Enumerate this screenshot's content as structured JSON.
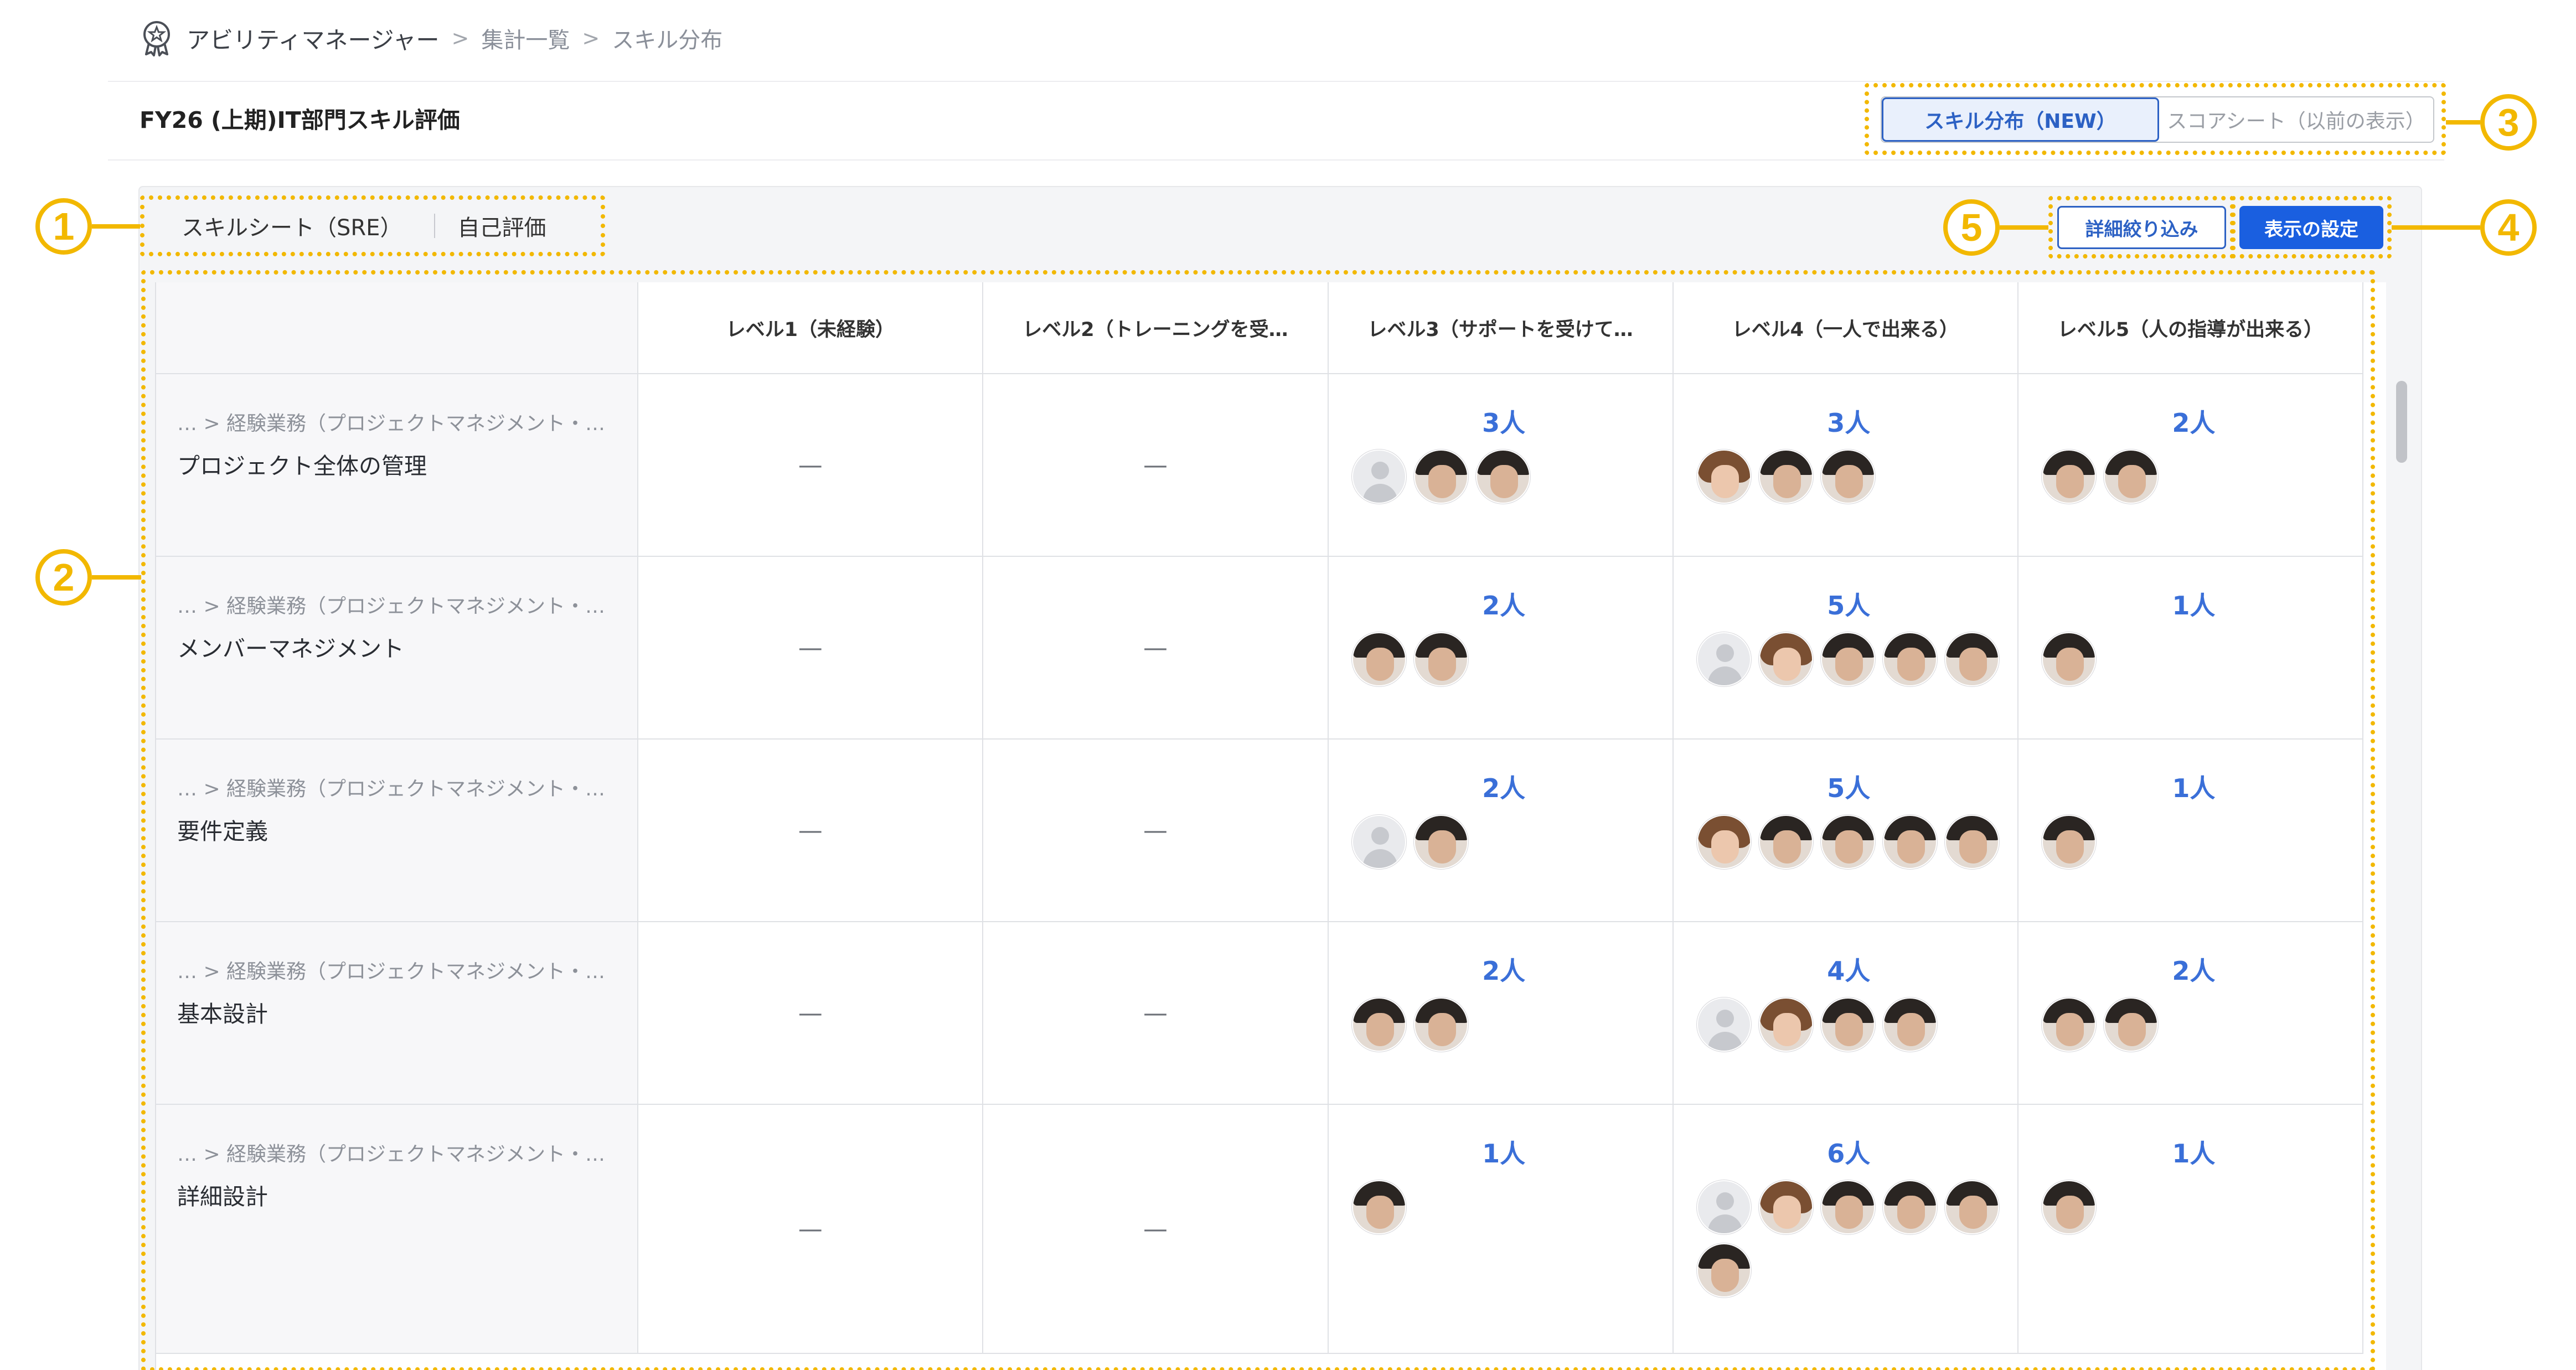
{
  "breadcrumb": {
    "app": "アビリティマネージャー",
    "items": [
      "集計一覧",
      "スキル分布"
    ],
    "separator": ">"
  },
  "header": {
    "title": "FY26 (上期)IT部門スキル評価",
    "view_toggle": {
      "active": "スキル分布（NEW）",
      "inactive": "スコアシート（以前の表示）"
    }
  },
  "toolbar": {
    "sheet": "スキルシート（SRE）",
    "evaluation": "自己評価",
    "filter_label": "詳細絞り込み",
    "settings_label": "表示の設定"
  },
  "table": {
    "columns": [
      "",
      "レベル1（未経験）",
      "レベル2（トレーニングを受…",
      "レベル3（サポートを受けて…",
      "レベル4（一人で出来る）",
      "レベル5（人の指導が出来る）"
    ],
    "empty_mark": "—",
    "rows": [
      {
        "path": "… > 経験業務（プロジェクトマネジメント・…",
        "name": "プロジェクト全体の管理",
        "levels": [
          null,
          null,
          {
            "count": "3人",
            "avatars": [
              "ph",
              "m",
              "m"
            ]
          },
          {
            "count": "3人",
            "avatars": [
              "f",
              "m",
              "m"
            ]
          },
          {
            "count": "2人",
            "avatars": [
              "m",
              "m"
            ]
          }
        ]
      },
      {
        "path": "… > 経験業務（プロジェクトマネジメント・…",
        "name": "メンバーマネジメント",
        "levels": [
          null,
          null,
          {
            "count": "2人",
            "avatars": [
              "m",
              "m"
            ]
          },
          {
            "count": "5人",
            "avatars": [
              "ph",
              "f",
              "m",
              "m",
              "m"
            ]
          },
          {
            "count": "1人",
            "avatars": [
              "m"
            ]
          }
        ]
      },
      {
        "path": "… > 経験業務（プロジェクトマネジメント・…",
        "name": "要件定義",
        "levels": [
          null,
          null,
          {
            "count": "2人",
            "avatars": [
              "ph",
              "m"
            ]
          },
          {
            "count": "5人",
            "avatars": [
              "f",
              "m",
              "m",
              "m",
              "m"
            ]
          },
          {
            "count": "1人",
            "avatars": [
              "m"
            ]
          }
        ]
      },
      {
        "path": "… > 経験業務（プロジェクトマネジメント・…",
        "name": "基本設計",
        "levels": [
          null,
          null,
          {
            "count": "2人",
            "avatars": [
              "m",
              "m"
            ]
          },
          {
            "count": "4人",
            "avatars": [
              "ph",
              "f",
              "m",
              "m"
            ]
          },
          {
            "count": "2人",
            "avatars": [
              "m",
              "m"
            ]
          }
        ]
      },
      {
        "path": "… > 経験業務（プロジェクトマネジメント・…",
        "name": "詳細設計",
        "levels": [
          null,
          null,
          {
            "count": "1人",
            "avatars": [
              "m"
            ]
          },
          {
            "count": "6人",
            "avatars": [
              "ph",
              "f",
              "m",
              "m",
              "m",
              "m"
            ]
          },
          {
            "count": "1人",
            "avatars": [
              "m"
            ]
          }
        ]
      }
    ]
  },
  "annotations": [
    "1",
    "2",
    "3",
    "4",
    "5"
  ],
  "colors": {
    "accent": "#2c61c4",
    "primary_button": "#1a5fe0",
    "callout": "#f2b800"
  },
  "icons": {
    "app": "award-badge-icon",
    "separator": "chevron-right-icon",
    "avatar_placeholder": "user-silhouette-icon"
  }
}
